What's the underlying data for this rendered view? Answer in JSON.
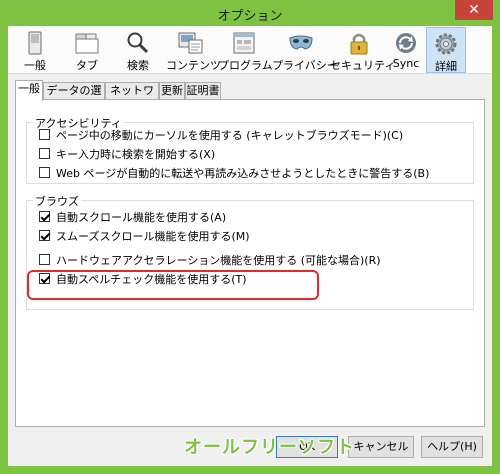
{
  "window": {
    "title": "オプション",
    "close_glyph": "✕"
  },
  "toolbar": {
    "items": [
      {
        "label": "一般",
        "icon": "switch-icon"
      },
      {
        "label": "タブ",
        "icon": "tabs-icon"
      },
      {
        "label": "検索",
        "icon": "magnifier-icon"
      },
      {
        "label": "コンテンツ",
        "icon": "content-icon"
      },
      {
        "label": "プログラム",
        "icon": "applications-icon"
      },
      {
        "label": "プライバシー",
        "icon": "mask-icon"
      },
      {
        "label": "セキュリティ",
        "icon": "padlock-icon"
      },
      {
        "label": "Sync",
        "icon": "sync-icon"
      },
      {
        "label": "詳細",
        "icon": "gear-icon",
        "selected": true
      }
    ]
  },
  "tabs": [
    {
      "label": "一般",
      "active": true
    },
    {
      "label": "データの選択"
    },
    {
      "label": "ネットワーク"
    },
    {
      "label": "更新"
    },
    {
      "label": "証明書"
    }
  ],
  "accessibility": {
    "title": "アクセシビリティ",
    "options": [
      {
        "label": "ページ中の移動にカーソルを使用する (キャレットブラウズモード)(C)",
        "checked": false
      },
      {
        "label": "キー入力時に検索を開始する(X)",
        "checked": false
      },
      {
        "label": "Web ページが自動的に転送や再読み込みさせようとしたときに警告する(B)",
        "checked": false
      }
    ]
  },
  "browsing": {
    "title": "ブラウズ",
    "options": [
      {
        "label": "自動スクロール機能を使用する(A)",
        "checked": true
      },
      {
        "label": "スムーズスクロール機能を使用する(M)",
        "checked": true
      },
      {
        "label": "ハードウェアアクセラレーション機能を使用する (可能な場合)(R)",
        "checked": false
      },
      {
        "label": "自動スペルチェック機能を使用する(T)",
        "checked": true
      }
    ]
  },
  "buttons": {
    "ok": "OK",
    "cancel": "キャンセル",
    "help": "ヘルプ(H)"
  },
  "watermark": "オールフリーソフト",
  "colors": {
    "frame": "#7ec242",
    "close": "#c7443a",
    "highlight": "#e22b2b",
    "selected": "#cfe3f7"
  }
}
